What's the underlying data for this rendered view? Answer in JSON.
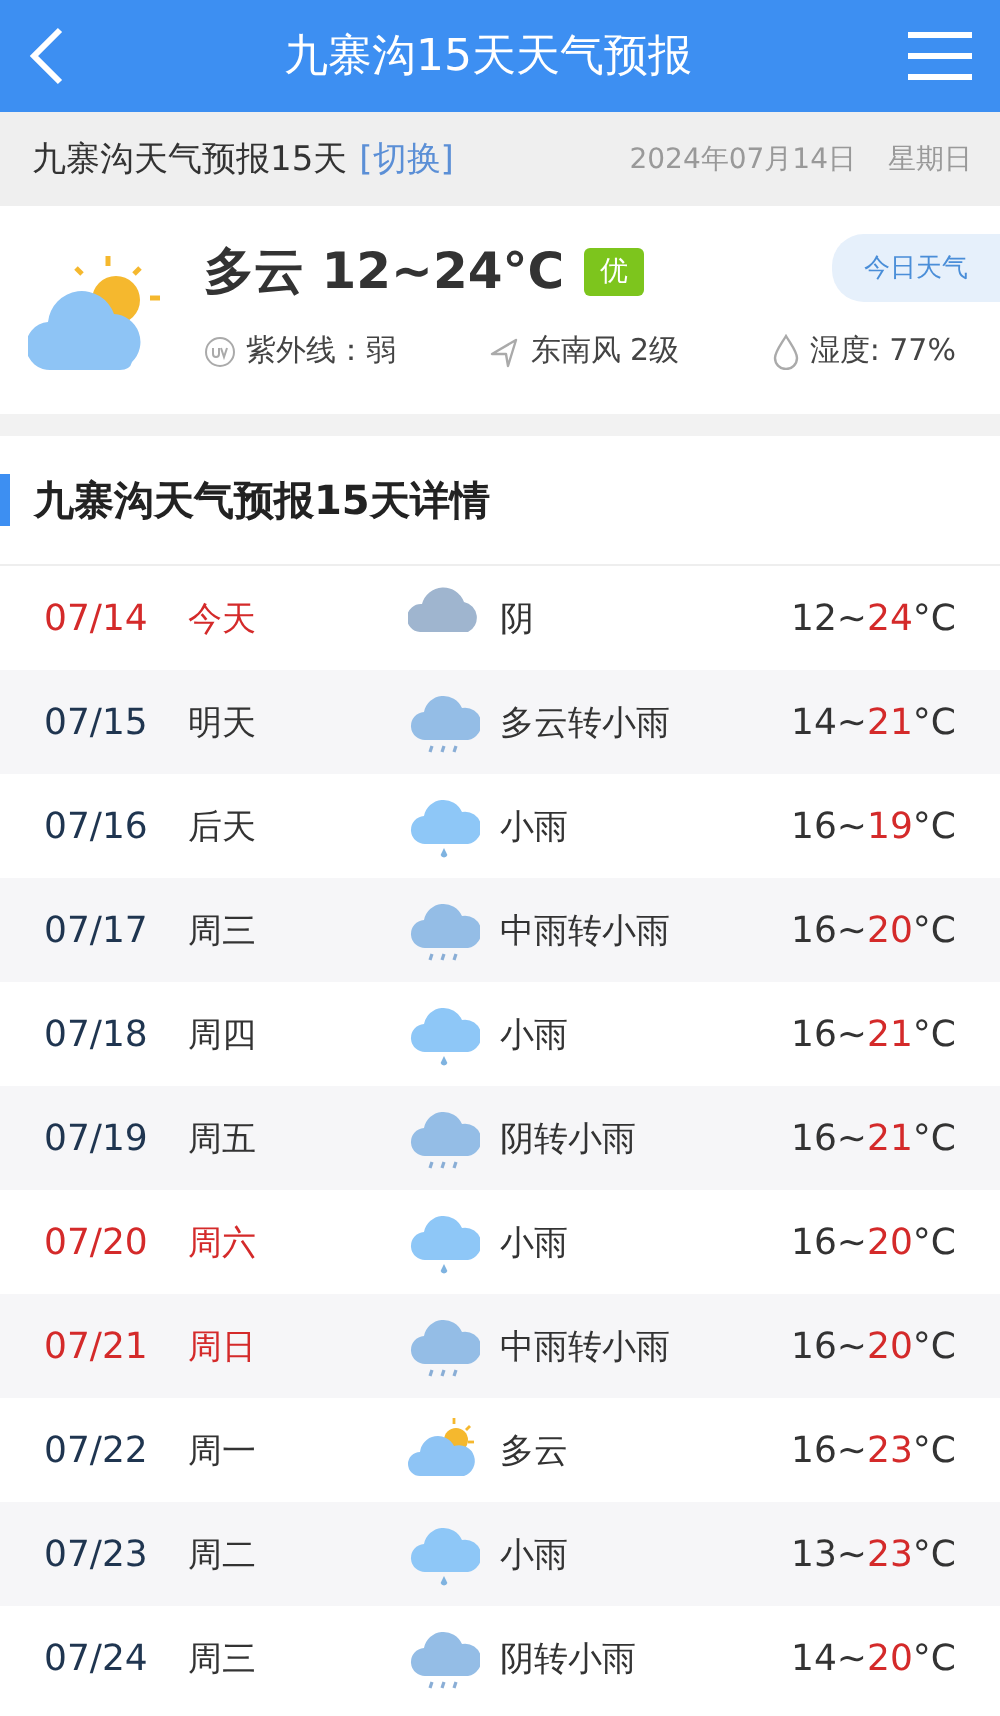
{
  "header": {
    "title": "九寨沟15天天气预报"
  },
  "subheader": {
    "title": "九寨沟天气预报15天",
    "link": "[切换]",
    "date": "2024年07月14日",
    "weekday": "星期日"
  },
  "today": {
    "condition": "多云 12~24°C",
    "aqi": "优",
    "tag": "今日天气",
    "uv": "紫外线：弱",
    "wind": "东南风 2级",
    "humidity": "湿度: 77%"
  },
  "section_title": "九寨沟天气预报15天详情",
  "days": [
    {
      "date": "07/14",
      "day": "今天",
      "highlight": true,
      "kind": "overcast",
      "condition": "阴",
      "low": "12~",
      "high": "24",
      "unit": "°C"
    },
    {
      "date": "07/15",
      "day": "明天",
      "highlight": false,
      "kind": "showers",
      "condition": "多云转小雨",
      "low": "14~",
      "high": "21",
      "unit": "°C"
    },
    {
      "date": "07/16",
      "day": "后天",
      "highlight": false,
      "kind": "rain",
      "condition": "小雨",
      "low": "16~",
      "high": "19",
      "unit": "°C"
    },
    {
      "date": "07/17",
      "day": "周三",
      "highlight": false,
      "kind": "showers",
      "condition": "中雨转小雨",
      "low": "16~",
      "high": "20",
      "unit": "°C"
    },
    {
      "date": "07/18",
      "day": "周四",
      "highlight": false,
      "kind": "rain",
      "condition": "小雨",
      "low": "16~",
      "high": "21",
      "unit": "°C"
    },
    {
      "date": "07/19",
      "day": "周五",
      "highlight": false,
      "kind": "showers",
      "condition": "阴转小雨",
      "low": "16~",
      "high": "21",
      "unit": "°C"
    },
    {
      "date": "07/20",
      "day": "周六",
      "highlight": true,
      "kind": "rain",
      "condition": "小雨",
      "low": "16~",
      "high": "20",
      "unit": "°C"
    },
    {
      "date": "07/21",
      "day": "周日",
      "highlight": true,
      "kind": "showers",
      "condition": "中雨转小雨",
      "low": "16~",
      "high": "20",
      "unit": "°C"
    },
    {
      "date": "07/22",
      "day": "周一",
      "highlight": false,
      "kind": "partly-cloudy",
      "condition": "多云",
      "low": "16~",
      "high": "23",
      "unit": "°C"
    },
    {
      "date": "07/23",
      "day": "周二",
      "highlight": false,
      "kind": "rain",
      "condition": "小雨",
      "low": "13~",
      "high": "23",
      "unit": "°C"
    },
    {
      "date": "07/24",
      "day": "周三",
      "highlight": false,
      "kind": "showers",
      "condition": "阴转小雨",
      "low": "14~",
      "high": "20",
      "unit": "°C"
    }
  ]
}
